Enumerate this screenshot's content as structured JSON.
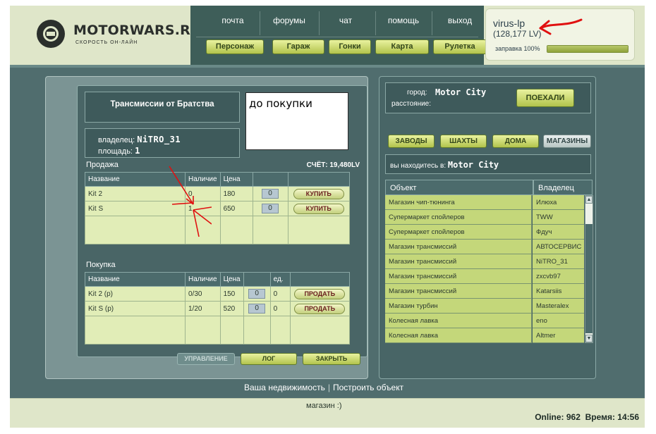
{
  "logo": {
    "name": "MOTORWARS.RU",
    "tagline": "СКОРОСТЬ ОН-ЛАЙН"
  },
  "nav": {
    "top_links": [
      "почта",
      "форумы",
      "чат",
      "помощь",
      "выход"
    ],
    "buttons": [
      "Персонаж",
      "Гараж",
      "Гонки",
      "Карта",
      "Рулетка"
    ]
  },
  "user": {
    "name": "virus-lp",
    "lv": "(128,177 LV)",
    "fuel_label": "заправка 100%",
    "fuel_percent": 100
  },
  "shop": {
    "title": "Трансмиссии от Братства",
    "owner_label": "владелец:",
    "owner": "NiTRO_31",
    "area_label": "площадь:",
    "area": "1",
    "note": "до покупки",
    "sale_label": "Продажа",
    "account": "СЧЁТ: 19,480LV",
    "sale_headers": [
      "Название",
      "Наличие",
      "Цена",
      "",
      ""
    ],
    "sale_rows": [
      {
        "name": "Kit 2",
        "stock": "0",
        "price": "180",
        "qty": "0",
        "action": "КУПИТЬ"
      },
      {
        "name": "Kit S",
        "stock": "1",
        "price": "650",
        "qty": "0",
        "action": "КУПИТЬ"
      }
    ],
    "buy_label": "Покупка",
    "buy_headers": [
      "Название",
      "Наличие",
      "Цена",
      "",
      "ед.",
      ""
    ],
    "buy_rows": [
      {
        "name": "Kit 2 (p)",
        "stock": "0/30",
        "price": "150",
        "qty": "0",
        "unit": "0",
        "action": "ПРОДАТЬ"
      },
      {
        "name": "Kit S (p)",
        "stock": "1/20",
        "price": "520",
        "qty": "0",
        "unit": "0",
        "action": "ПРОДАТЬ"
      }
    ],
    "bottom_buttons": [
      "УПРАВЛЕНИЕ",
      "ЛОГ",
      "ЗАКРЫТЬ"
    ]
  },
  "city": {
    "city_label": "город:",
    "city": "Motor City",
    "distance_label": "расстояние:",
    "go": "ПОЕХАЛИ",
    "categories": [
      "ЗАВОДЫ",
      "ШАХТЫ",
      "ДОМА",
      "МАГАЗИНЫ"
    ],
    "here_label": "вы находитесь в:",
    "here": "Motor City",
    "list_headers": [
      "Объект",
      "Владелец"
    ],
    "list": [
      {
        "object": "Магазин чип-тюнинга",
        "owner": "Илюха"
      },
      {
        "object": "Супермаркет спойлеров",
        "owner": "TWW"
      },
      {
        "object": "Супермаркет спойлеров",
        "owner": "Фдуч"
      },
      {
        "object": "Магазин трансмиссий",
        "owner": "АВТОСЕРВИС"
      },
      {
        "object": "Магазин трансмиссий",
        "owner": "NiTRO_31"
      },
      {
        "object": "Магазин трансмиссий",
        "owner": "zxcvb97"
      },
      {
        "object": "Магазин трансмиссий",
        "owner": "Katarsiis"
      },
      {
        "object": "Магазин турбин",
        "owner": "Masteralex"
      },
      {
        "object": "Колесная лавка",
        "owner": "eno"
      },
      {
        "object": "Колесная лавка",
        "owner": "Altmer"
      }
    ]
  },
  "footer": {
    "link1": "Ваша недвижимость",
    "sep": "|",
    "link2": "Построить объект",
    "shop_tag": "магазин :)",
    "online": "Online: 962",
    "time": "Время: 14:56"
  },
  "colors": {
    "accent_green": "#b2c34c",
    "panel_teal": "#506d6e",
    "header_bg": "#dfe6c9",
    "annotation_red": "#e01010"
  }
}
